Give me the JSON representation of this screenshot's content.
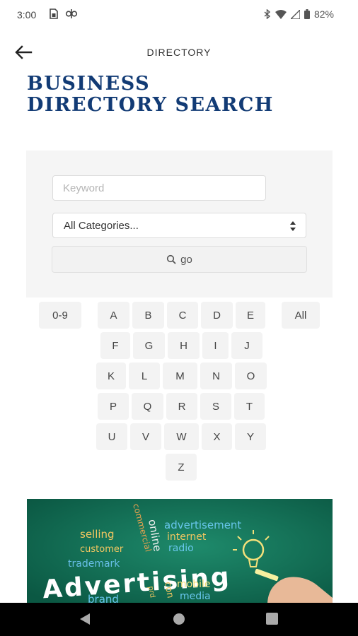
{
  "status_bar": {
    "time": "3:00",
    "battery": "82%",
    "icons": [
      "sim-card-icon",
      "link-icon",
      "bluetooth-icon",
      "wifi-icon",
      "signal-icon",
      "battery-icon"
    ]
  },
  "app_bar": {
    "title": "DIRECTORY",
    "back_icon": "arrow-left-icon"
  },
  "page": {
    "title_line1": "BUSINESS",
    "title_line2": "DIRECTORY SEARCH"
  },
  "search": {
    "keyword_placeholder": "Keyword",
    "keyword_value": "",
    "category_selected": "All Categories...",
    "go_label": "go",
    "go_icon": "search-icon"
  },
  "letters": {
    "special_left": "0-9",
    "special_right": "All",
    "rows": [
      [
        "A",
        "B",
        "C",
        "D",
        "E"
      ],
      [
        "F",
        "G",
        "H",
        "I",
        "J"
      ],
      [
        "K",
        "L",
        "M",
        "N",
        "O"
      ],
      [
        "P",
        "Q",
        "R",
        "S",
        "T"
      ],
      [
        "U",
        "V",
        "W",
        "X",
        "Y"
      ],
      [
        "Z"
      ]
    ]
  },
  "banner": {
    "headline": "Advertising",
    "words": [
      "selling",
      "customer",
      "trademark",
      "brand",
      "commercial",
      "online",
      "advertisement",
      "internet",
      "radio",
      "mobile",
      "media",
      "con",
      "prd"
    ]
  },
  "colors": {
    "title": "#123b75",
    "panel_bg": "#f5f5f5",
    "key_bg": "#f3f3f3",
    "banner_bg": "#0f6b52"
  },
  "nav_bar": {
    "icons": [
      "back-triangle-icon",
      "home-circle-icon",
      "recents-square-icon"
    ]
  }
}
